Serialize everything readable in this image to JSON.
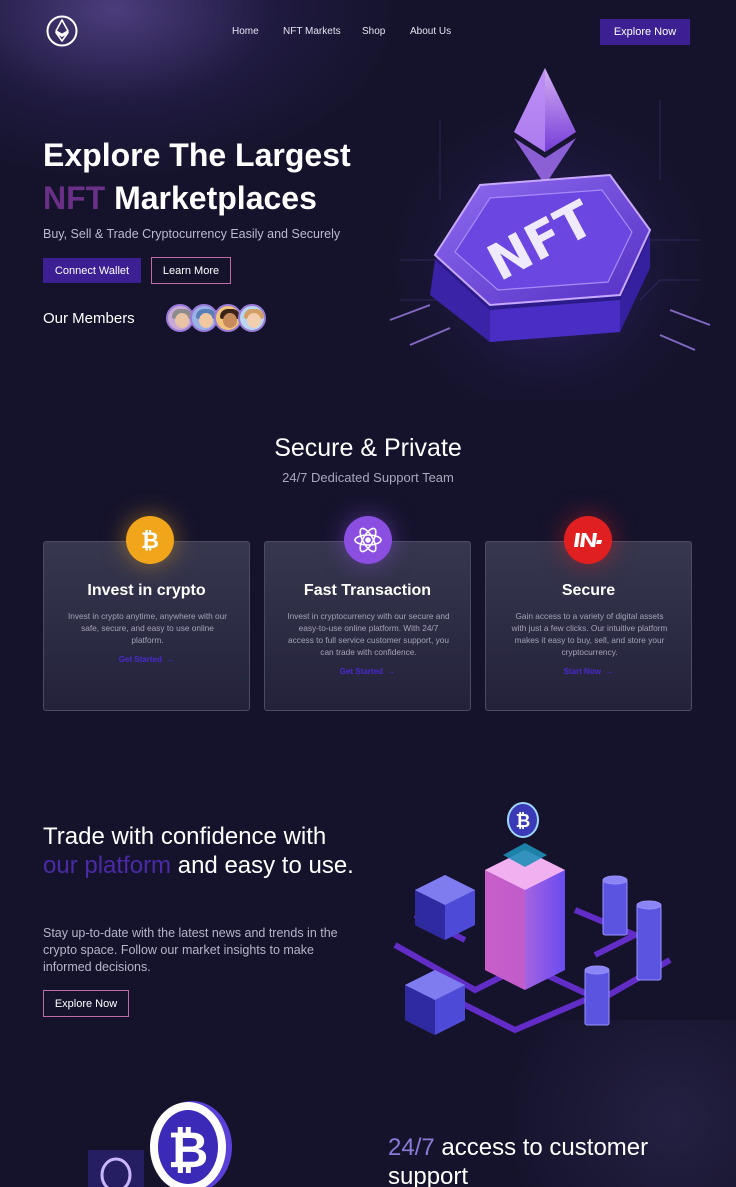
{
  "nav": {
    "links": [
      "Home",
      "NFT Markets",
      "Shop",
      "About Us"
    ],
    "cta": "Explore Now"
  },
  "hero": {
    "title_line1": "Explore The Largest",
    "title_accent": "NFT",
    "title_rest": " Marketplaces",
    "subtitle": "Buy, Sell & Trade Cryptocurrency Easily and Securely",
    "connect_wallet": "Connect Wallet",
    "learn_more": "Learn More",
    "members_label": "Our Members",
    "art_label": "NFT"
  },
  "features": {
    "title": "Secure & Private",
    "subtitle": "24/7 Dedicated Support Team",
    "cards": [
      {
        "title": "Invest in crypto",
        "text": "Invest in crypto anytime, anywhere with our safe, secure, and easy to use online platform.",
        "link": "Get Started",
        "icon": "bitcoin-icon",
        "icon_color": "#f0a51a"
      },
      {
        "title": "Fast Transaction",
        "text": "Invest in cryptocurrency with our secure and easy-to-use online platform. With 24/7 access to full service customer support, you can trade with confidence.",
        "link": "Get Started",
        "icon": "atom-icon",
        "icon_color": "#8a4fe0"
      },
      {
        "title": "Secure",
        "text": "Gain access to a variety of digital assets with just a few clicks. Our intuitive platform makes it easy to buy, sell, and store your cryptocurrency.",
        "link": "Start Now",
        "icon": "secure-logo-icon",
        "icon_color": "#e02020"
      }
    ]
  },
  "trade": {
    "title_part1": "Trade with confidence with ",
    "title_accent": "our platform",
    "title_part2": "  and easy to use.",
    "text": "Stay up-to-date with the latest news and trends in the crypto space. Follow our market insights to make informed decisions.",
    "cta": "Explore Now"
  },
  "support": {
    "title_accent": "24/7",
    "title_rest": " access to customer support"
  },
  "colors": {
    "background": "#15132c",
    "primary_button": "#3c1f93",
    "accent_purple": "#6a2f86",
    "outline_pink": "#c06aa8"
  }
}
